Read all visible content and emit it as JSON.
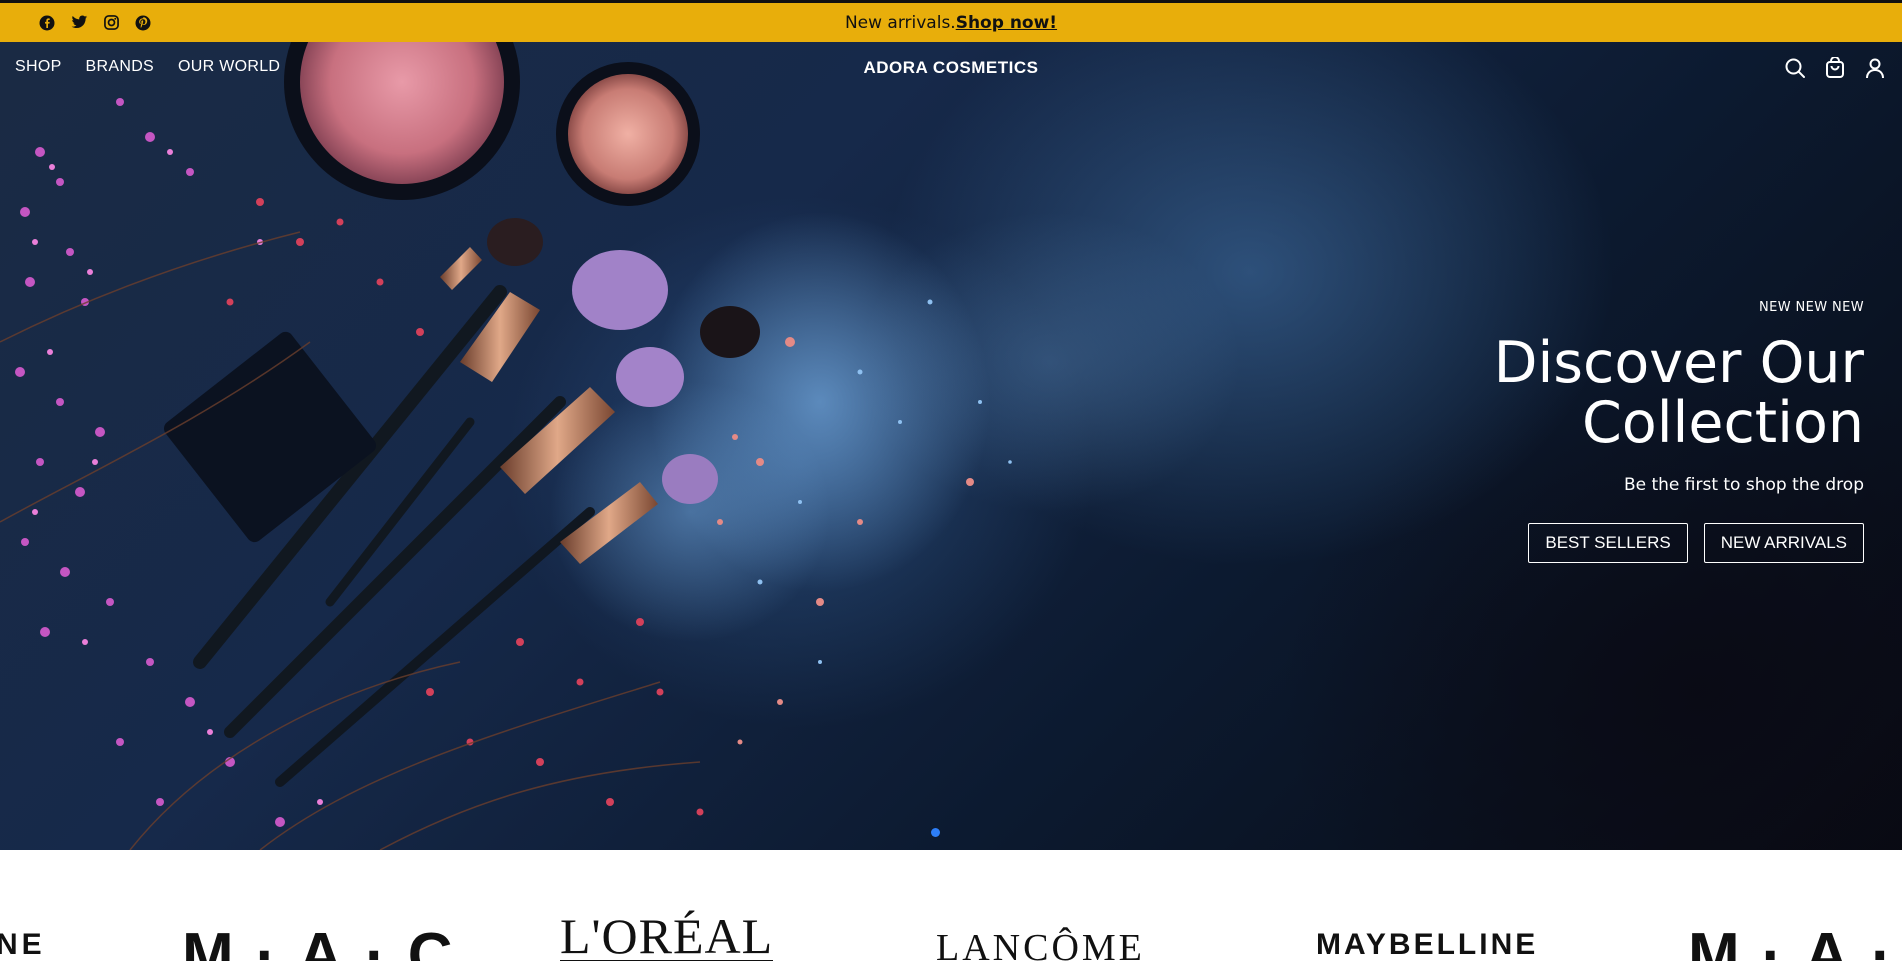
{
  "announcement": {
    "text": "New arrivals.",
    "link": "Shop now!",
    "socials": [
      "facebook-icon",
      "twitter-icon",
      "instagram-icon",
      "pinterest-icon"
    ]
  },
  "nav": {
    "items": [
      "SHOP",
      "BRANDS",
      "OUR WORLD"
    ],
    "brand": "ADORA COSMETICS",
    "icons": [
      "search-icon",
      "cart-icon",
      "account-icon"
    ]
  },
  "hero": {
    "eyebrow": "NEW NEW NEW",
    "headline": "Discover Our Collection",
    "subheadline": "Be the first to shop the drop",
    "buttons": [
      "BEST SELLERS",
      "NEW ARRIVALS"
    ],
    "slide_count": 1,
    "active_slide": 1
  },
  "brands_strip": {
    "logos": [
      "NE",
      "M·A·C",
      "L'ORÉAL",
      "LANCÔME",
      "MAYBELLINE",
      "M·A·C"
    ]
  },
  "colors": {
    "announcement_bg": "#e8ae0b",
    "hero_bg": "#14233e",
    "accent_dot": "#2d7ef7"
  }
}
